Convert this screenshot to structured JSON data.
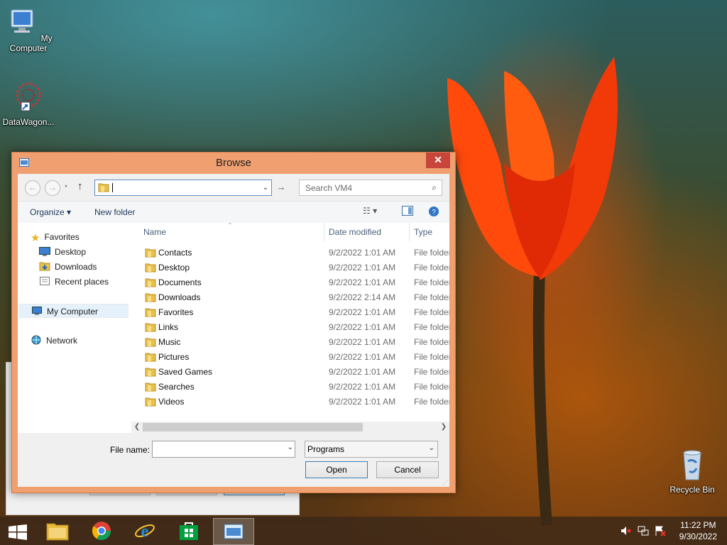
{
  "desktop": {
    "icons": [
      {
        "label": "My Computer"
      },
      {
        "label": "DataWagon..."
      },
      {
        "label": "Recycle Bin"
      }
    ]
  },
  "dialog": {
    "title": "Browse",
    "close_glyph": "✕",
    "search_placeholder": "Search VM4",
    "address_value": "",
    "toolbar": {
      "organize": "Organize ▾",
      "new_folder": "New folder",
      "view_icon": "view-details-icon",
      "preview_icon": "preview-pane-icon",
      "help_icon": "help-icon"
    },
    "nav": {
      "favorites": "Favorites",
      "desktop": "Desktop",
      "downloads": "Downloads",
      "recent_places": "Recent places",
      "my_computer": "My Computer",
      "network": "Network"
    },
    "columns": {
      "name": "Name",
      "date_modified": "Date modified",
      "type": "Type"
    },
    "files": [
      {
        "name": "Contacts",
        "date": "9/2/2022 1:01 AM",
        "type": "File folder"
      },
      {
        "name": "Desktop",
        "date": "9/2/2022 1:01 AM",
        "type": "File folder"
      },
      {
        "name": "Documents",
        "date": "9/2/2022 1:01 AM",
        "type": "File folder"
      },
      {
        "name": "Downloads",
        "date": "9/2/2022 2:14 AM",
        "type": "File folder"
      },
      {
        "name": "Favorites",
        "date": "9/2/2022 1:01 AM",
        "type": "File folder"
      },
      {
        "name": "Links",
        "date": "9/2/2022 1:01 AM",
        "type": "File folder"
      },
      {
        "name": "Music",
        "date": "9/2/2022 1:01 AM",
        "type": "File folder"
      },
      {
        "name": "Pictures",
        "date": "9/2/2022 1:01 AM",
        "type": "File folder"
      },
      {
        "name": "Saved Games",
        "date": "9/2/2022 1:01 AM",
        "type": "File folder"
      },
      {
        "name": "Searches",
        "date": "9/2/2022 1:01 AM",
        "type": "File folder"
      },
      {
        "name": "Videos",
        "date": "9/2/2022 1:01 AM",
        "type": "File folder"
      }
    ],
    "file_name_label": "File name:",
    "file_name_value": "",
    "file_type": "Programs",
    "open_label": "Open",
    "cancel_label": "Cancel"
  },
  "taskbar": {
    "time": "11:22 PM",
    "date": "9/30/2022"
  },
  "colors": {
    "title_bar": "#f0a070",
    "close_button": "#c7453a",
    "taskbar": "#3c2819",
    "selection": "#e5f1fb"
  }
}
